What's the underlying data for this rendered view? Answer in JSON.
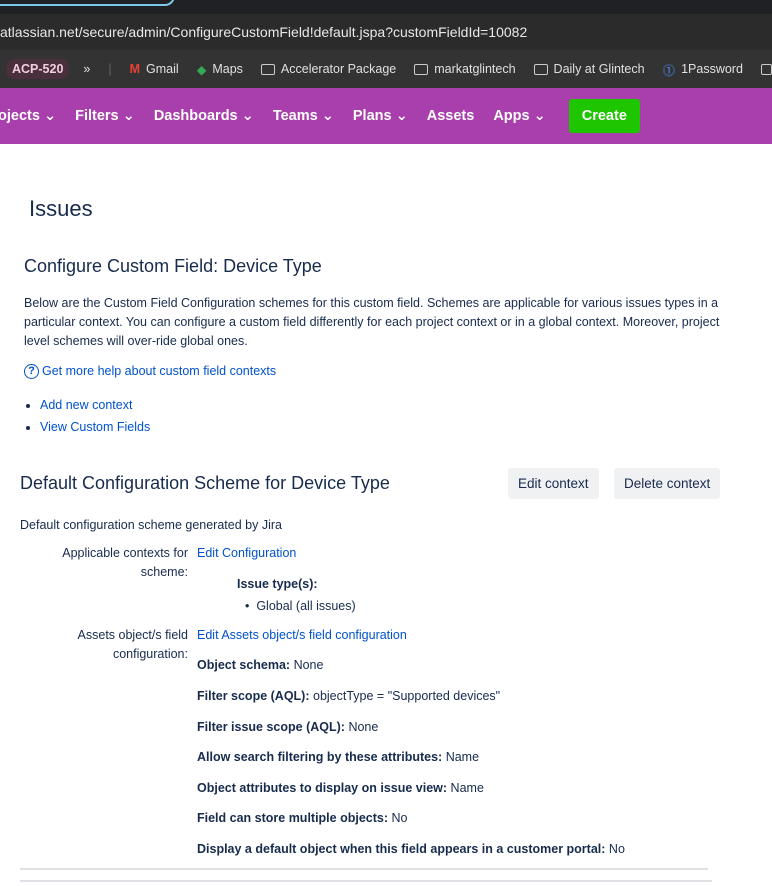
{
  "browser": {
    "url": "atlassian.net/secure/admin/ConfigureCustomField!default.jspa?customFieldId=10082",
    "bookmarks": {
      "chip": "ACP-520",
      "more": "»",
      "items": [
        "Gmail",
        "Maps",
        "Accelerator Package",
        "markatglintech",
        "Daily at Glintech",
        "1Password"
      ]
    }
  },
  "nav": {
    "items": [
      "ojects",
      "Filters",
      "Dashboards",
      "Teams",
      "Plans",
      "Assets",
      "Apps"
    ],
    "create": "Create"
  },
  "page": {
    "title": "Issues",
    "heading": "Configure Custom Field: Device Type",
    "description": "Below are the Custom Field Configuration schemes for this custom field. Schemes are applicable for various issues types in a particular context. You can configure a custom field differently for each project context or in a global context. Moreover, project level schemes will over-ride global ones.",
    "help_link": "Get more help about custom field contexts",
    "links": [
      "Add new context",
      "View Custom Fields"
    ]
  },
  "scheme": {
    "title": "Default Configuration Scheme for Device Type",
    "edit_context": "Edit context",
    "delete_context": "Delete context",
    "subtitle": "Default configuration scheme generated by Jira",
    "contexts_label": "Applicable contexts for scheme:",
    "edit_configuration": "Edit Configuration",
    "issue_types_label": "Issue type(s):",
    "issue_types": [
      "Global (all issues)"
    ],
    "assets_label": "Assets object/s field configuration:",
    "edit_assets": "Edit Assets object/s field configuration",
    "props": [
      {
        "k": "Object schema:",
        "v": "None"
      },
      {
        "k": "Filter scope (AQL):",
        "v": "objectType = \"Supported devices\""
      },
      {
        "k": "Filter issue scope (AQL):",
        "v": "None"
      },
      {
        "k": "Allow search filtering by these attributes:",
        "v": "Name"
      },
      {
        "k": "Object attributes to display on issue view:",
        "v": "Name"
      },
      {
        "k": "Field can store multiple objects:",
        "v": "No"
      },
      {
        "k": "Display a default object when this field appears in a customer portal:",
        "v": "No"
      }
    ]
  }
}
